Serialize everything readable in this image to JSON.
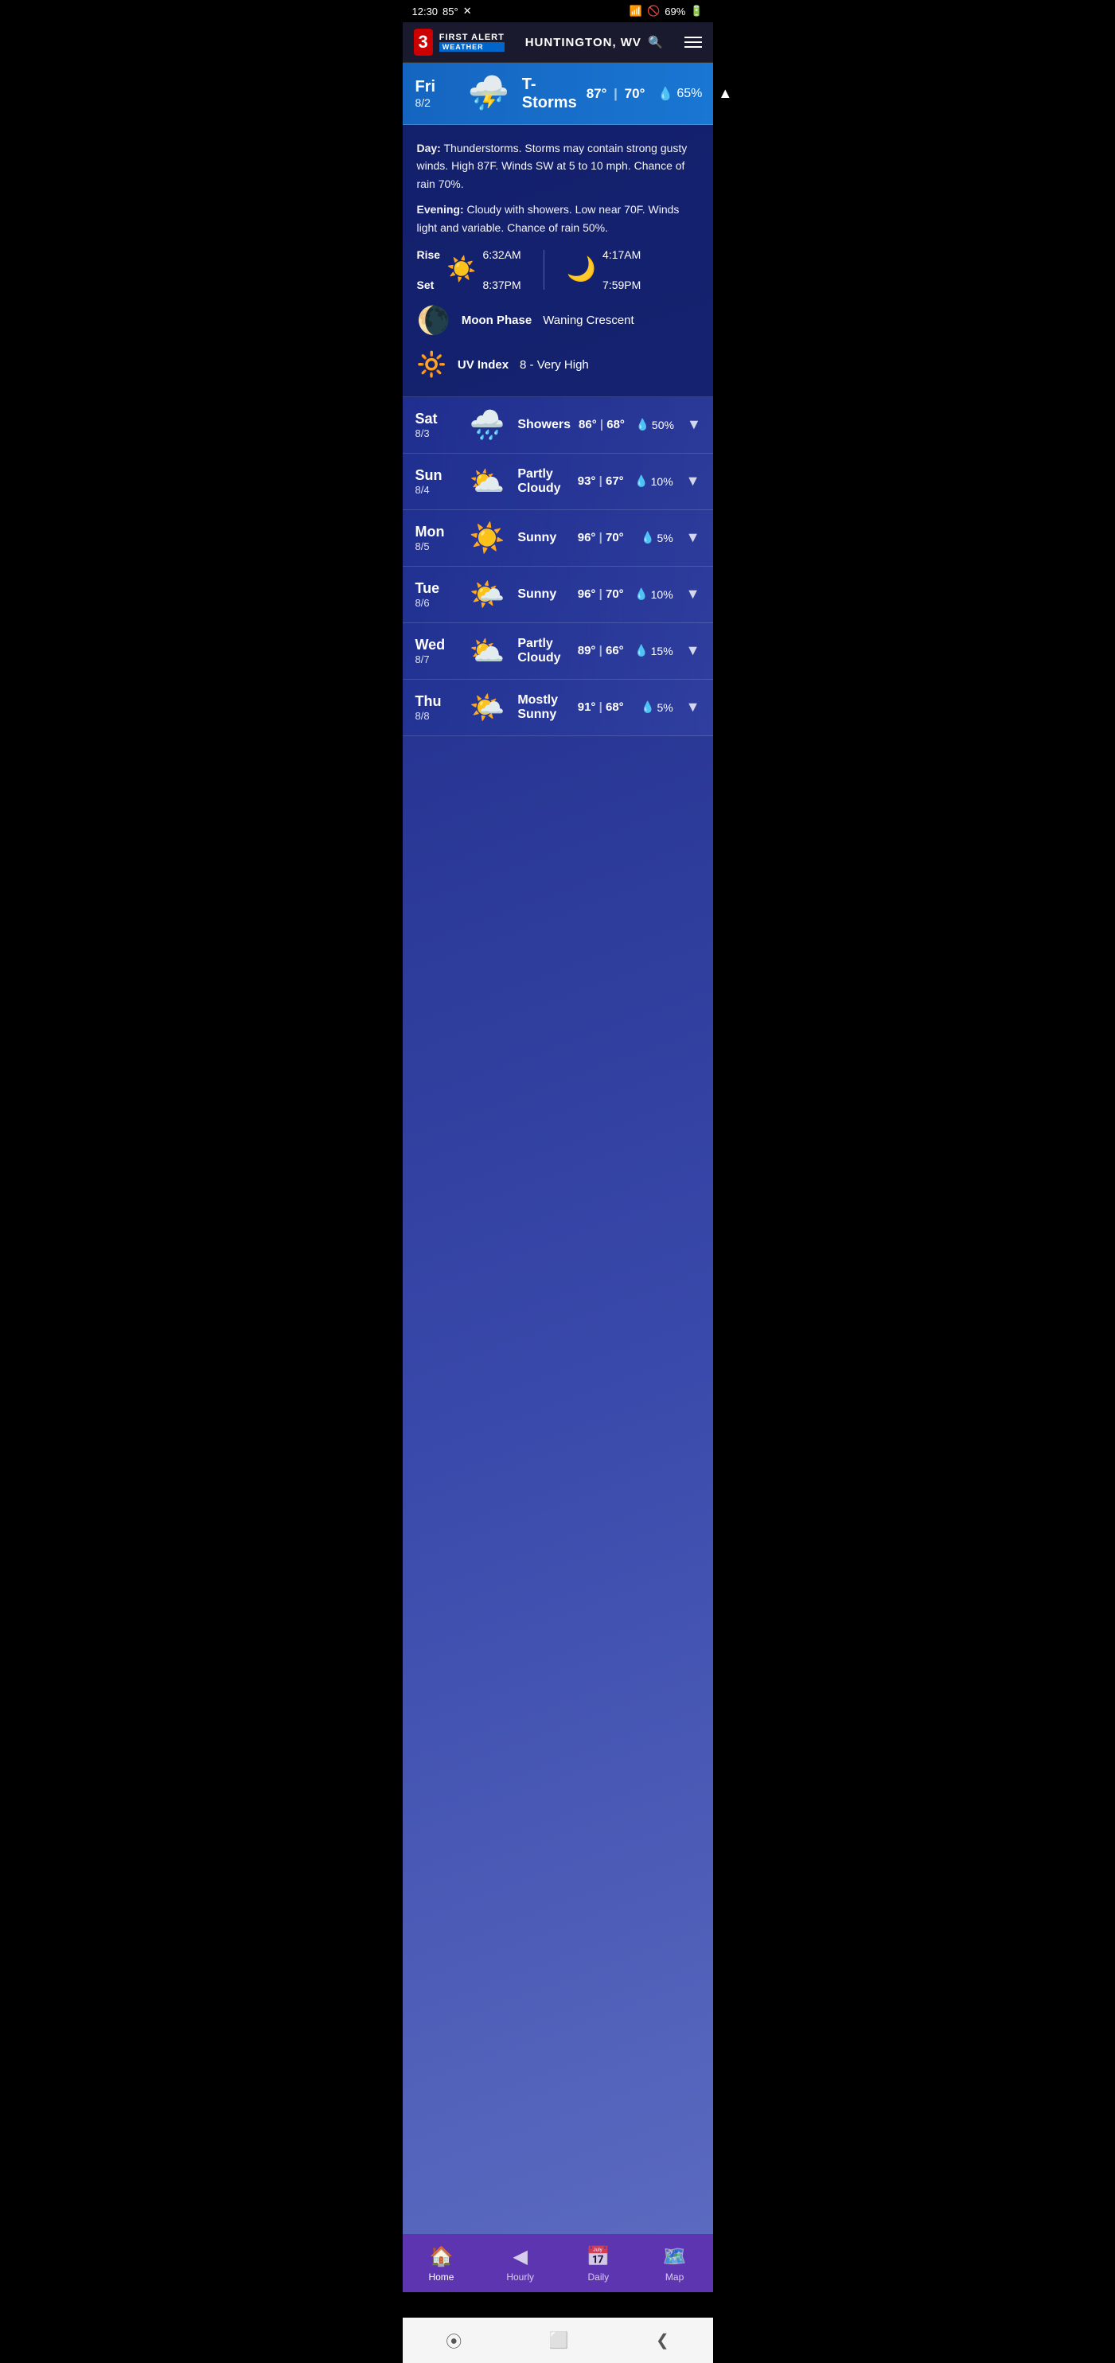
{
  "status_bar": {
    "time": "12:30",
    "temp": "85°",
    "battery": "69%",
    "wifi": "wifi",
    "signal": "signal"
  },
  "header": {
    "channel": "3",
    "brand": "FIRST ALERT",
    "weather": "WEATHER",
    "location": "HUNTINGTON, WV",
    "search_icon": "🔍",
    "menu_icon": "☰"
  },
  "current_day": {
    "day": "Fri",
    "date": "8/2",
    "condition": "T-Storms",
    "high": "87°",
    "low": "70°",
    "rain": "65%",
    "icon": "⛈️",
    "expanded": true,
    "detail": {
      "day_desc": "Day: Thunderstorms. Storms may contain strong gusty winds. High 87F. Winds SW at 5 to 10 mph. Chance of rain 70%.",
      "evening_desc": "Evening: Cloudy with showers. Low near 70F. Winds light and variable. Chance of rain 50%.",
      "sun_rise": "6:32AM",
      "sun_set": "8:37PM",
      "moon_rise": "4:17AM",
      "moon_set": "7:59PM",
      "moon_phase": "Waning Crescent",
      "uv_index": "8 - Very High"
    }
  },
  "forecast": [
    {
      "day": "Sat",
      "date": "8/3",
      "condition": "Showers",
      "high": "86°",
      "low": "68°",
      "rain": "50%",
      "icon": "🌧️"
    },
    {
      "day": "Sun",
      "date": "8/4",
      "condition": "Partly\nCloudy",
      "high": "93°",
      "low": "67°",
      "rain": "10%",
      "icon": "⛅"
    },
    {
      "day": "Mon",
      "date": "8/5",
      "condition": "Sunny",
      "high": "96°",
      "low": "70°",
      "rain": "5%",
      "icon": "☀️"
    },
    {
      "day": "Tue",
      "date": "8/6",
      "condition": "Sunny",
      "high": "96°",
      "low": "70°",
      "rain": "10%",
      "icon": "🌤️"
    },
    {
      "day": "Wed",
      "date": "8/7",
      "condition": "Partly\nCloudy",
      "high": "89°",
      "low": "66°",
      "rain": "15%",
      "icon": "⛅"
    },
    {
      "day": "Thu",
      "date": "8/8",
      "condition": "Mostly\nSunny",
      "high": "91°",
      "low": "68°",
      "rain": "5%",
      "icon": "🌤️"
    }
  ],
  "bottom_nav": {
    "items": [
      {
        "label": "Home",
        "icon": "🏠",
        "active": true
      },
      {
        "label": "Hourly",
        "icon": "◀",
        "active": false
      },
      {
        "label": "Daily",
        "icon": "📅",
        "active": false
      },
      {
        "label": "Map",
        "icon": "🗺️",
        "active": false
      }
    ]
  },
  "android_nav": {
    "back": "❮",
    "home": "⬜",
    "recent": "⦿"
  }
}
